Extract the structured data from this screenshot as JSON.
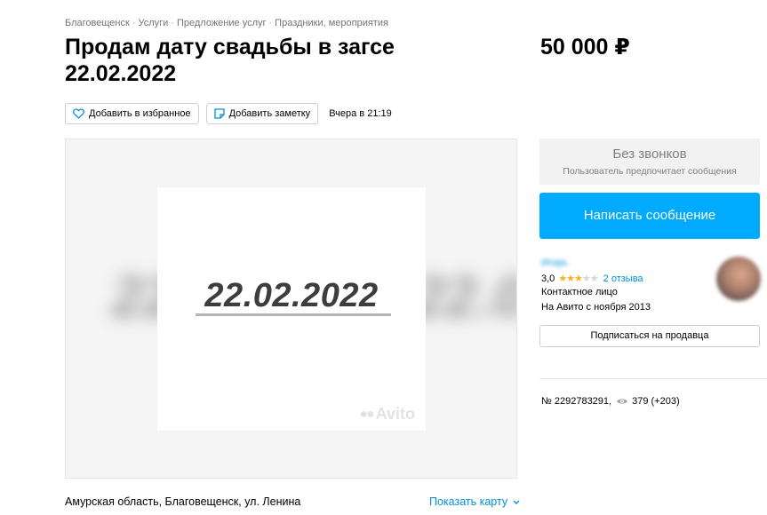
{
  "breadcrumb": {
    "items": [
      "Благовещенск",
      "Услуги",
      "Предложение услуг",
      "Праздники, мероприятия"
    ],
    "separator": "·"
  },
  "listing": {
    "title": "Продам дату свадьбы в загсе 22.02.2022",
    "price": "50 000 ₽",
    "published": "Вчера в 21:19",
    "photo_text": "22.02.2022",
    "watermark": "Avito",
    "address": "Амурская область, Благовещенск, ул. Ленина",
    "show_map": "Показать карту",
    "number": "№ 2292783291,",
    "views": "379 (+203)"
  },
  "actions": {
    "favorite": "Добавить в избранное",
    "note": "Добавить заметку"
  },
  "contact": {
    "no_calls_title": "Без звонков",
    "no_calls_subtitle": "Пользователь предпочитает сообщения",
    "write_button": "Написать сообщение"
  },
  "seller": {
    "name": "Игорь",
    "rating": "3,0",
    "stars_filled": 3,
    "stars_total": 5,
    "reviews": "2 отзыва",
    "role": "Контактное лицо",
    "since": "На Авито с ноября 2013",
    "subscribe": "Подписаться на продавца"
  },
  "colors": {
    "accent": "#00aaff",
    "link": "#0091d9",
    "star": "#ffb021"
  }
}
